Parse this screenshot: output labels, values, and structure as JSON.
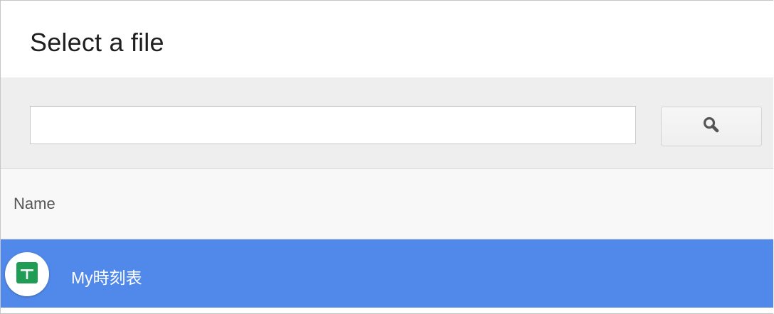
{
  "dialog": {
    "title": "Select a file"
  },
  "search": {
    "value": "",
    "placeholder": "",
    "button_icon": "search-icon"
  },
  "table": {
    "columns": [
      "Name"
    ],
    "rows": [
      {
        "name": "My時刻表",
        "icon": "google-sheets-icon",
        "selected": true
      }
    ]
  },
  "colors": {
    "selection": "#5189eb",
    "sheets_green": "#1f9d55",
    "search_bar_bg": "#eeeeee",
    "header_bg": "#f8f8f8"
  }
}
